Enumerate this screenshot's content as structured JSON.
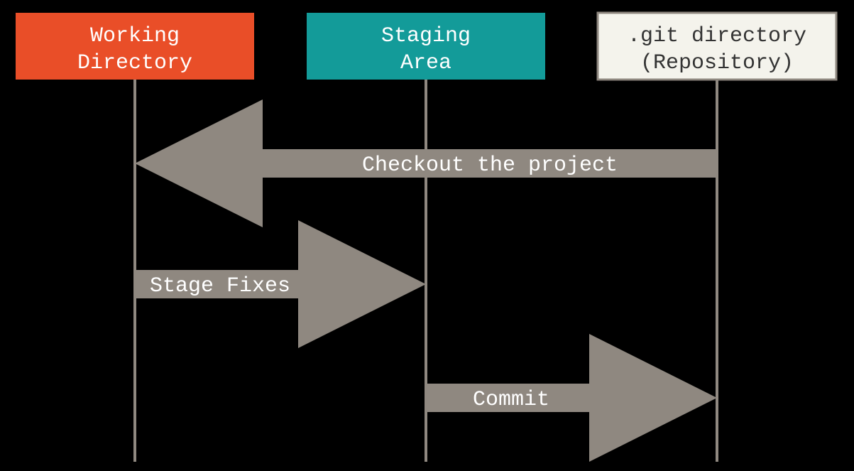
{
  "colors": {
    "working": "#E94E28",
    "staging": "#139B99",
    "repoFill": "#F4F3EC",
    "repoStroke": "#8F8880",
    "arrow": "#8F8880",
    "text": "#FFFFFF",
    "line": "#8F8880"
  },
  "boxes": {
    "working": {
      "line1": "Working",
      "line2": "Directory"
    },
    "staging": {
      "line1": "Staging",
      "line2": "Area"
    },
    "repo": {
      "line1": ".git directory",
      "line2": "(Repository)"
    }
  },
  "arrows": {
    "checkout": "Checkout the project",
    "stage": "Stage Fixes",
    "commit": "Commit"
  }
}
